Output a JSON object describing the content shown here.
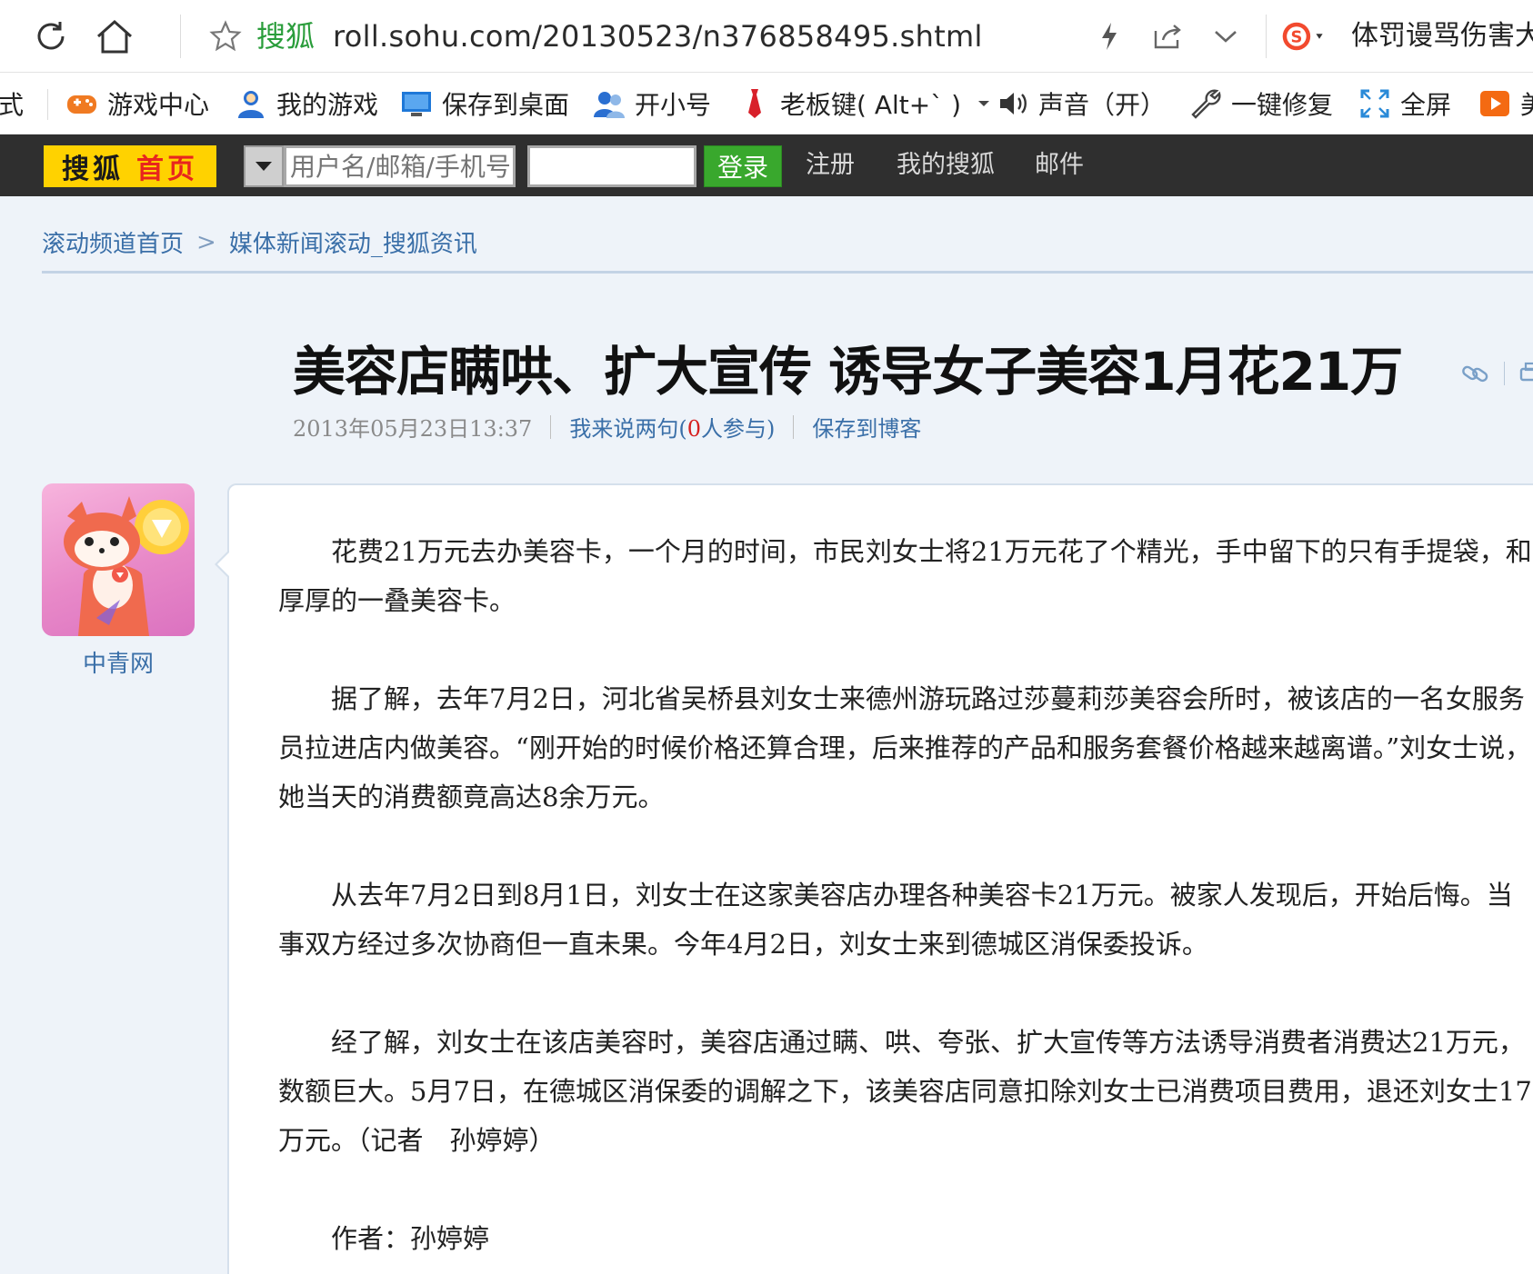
{
  "browser": {
    "site_label": "搜狐",
    "url": "roll.sohu.com/20130523/n376858495.shtml",
    "search_text": "体罚谩骂伤害大"
  },
  "toolbar": {
    "items": [
      {
        "label": "式",
        "icon": "cut-off-icon"
      },
      {
        "label": "游戏中心",
        "icon": "gamepad-icon"
      },
      {
        "label": "我的游戏",
        "icon": "user-icon"
      },
      {
        "label": "保存到桌面",
        "icon": "monitor-icon"
      },
      {
        "label": "开小号",
        "icon": "users-icon"
      },
      {
        "label": "老板键( Alt+` )",
        "icon": "tie-icon"
      },
      {
        "label": "声音（开）",
        "icon": "speaker-icon"
      },
      {
        "label": "一键修复",
        "icon": "wrench-icon"
      },
      {
        "label": "全屏",
        "icon": "fullscreen-icon"
      },
      {
        "label": "美",
        "icon": "video-icon"
      }
    ]
  },
  "sohu_nav": {
    "logo_a": "搜狐",
    "logo_b": "首页",
    "username_placeholder": "用户名/邮箱/手机号",
    "login_label": "登录",
    "links": [
      "注册",
      "我的搜狐",
      "邮件"
    ]
  },
  "breadcrumb": {
    "home": "滚动频道首页",
    "separator": ">",
    "current": "媒体新闻滚动_搜狐资讯"
  },
  "article": {
    "title": "美容店瞒哄、扩大宣传 诱导女子美容1月花21万",
    "date": "2013年05月23日13:37",
    "comment_prefix": "我来说两句(",
    "comment_count": "0",
    "comment_suffix": "人参与)",
    "save_blog": "保存到博客",
    "source_name": "中青网",
    "paragraphs": [
      "花费21万元去办美容卡，一个月的时间，市民刘女士将21万元花了个精光，手中留下的只有手提袋，和厚厚的一叠美容卡。",
      "据了解，去年7月2日，河北省吴桥县刘女士来德州游玩路过莎蔓莉莎美容会所时，被该店的一名女服务员拉进店内做美容。“刚开始的时候价格还算合理，后来推荐的产品和服务套餐价格越来越离谱。”刘女士说，她当天的消费额竟高达8余万元。",
      "从去年7月2日到8月1日，刘女士在这家美容店办理各种美容卡21万元。被家人发现后，开始后悔。当事双方经过多次协商但一直未果。今年4月2日，刘女士来到德城区消保委投诉。",
      "经了解，刘女士在该店美容时，美容店通过瞒、哄、夸张、扩大宣传等方法诱导消费者消费达21万元，数额巨大。5月7日，在德城区消保委的调解之下，该美容店同意扣除刘女士已消费项目费用，退还刘女士17万元。（记者　孙婷婷）"
    ],
    "author_line": "作者：孙婷婷"
  },
  "colors": {
    "page_bg": "#eef3f9",
    "nav_bg": "#2f2f2f",
    "logo_bg": "#ffd200",
    "login_green": "#39a82d",
    "link_blue": "#3a6fa8",
    "site_green": "#2a9d3b",
    "highlight_red": "#d62020"
  }
}
